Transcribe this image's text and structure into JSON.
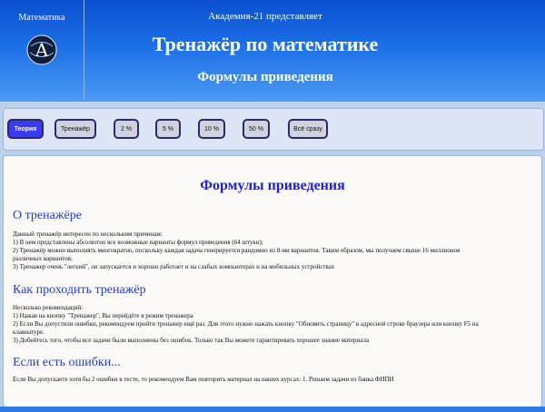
{
  "header": {
    "brand": "Математика",
    "logo_letter": "A",
    "presents": "Академия-21 представляет",
    "title": "Тренажёр по математике",
    "subtitle": "Формулы приведения"
  },
  "nav": {
    "buttons": [
      {
        "label": "Теория"
      },
      {
        "label": "Тренажёр"
      },
      {
        "label": "2 %"
      },
      {
        "label": "5 %"
      },
      {
        "label": "10 %"
      },
      {
        "label": "50 %"
      },
      {
        "label": "Всё сразу"
      }
    ]
  },
  "content": {
    "title": "Формулы приведения",
    "sections": [
      {
        "heading": "О тренажёре",
        "lines": [
          "Данный тренажёр интересен по нескольким причинам:",
          "1) В нем представлены абсолютно все возможные варианты формул приведения (64 штуки);",
          "2) Тренажёр можно выполнять многократно, поскольку каждая задача генерируется рандомно из 8-ми вариантов. Таким образом, мы получаем свыше 16 миллионов",
          "различных вариантов;",
          "3) Тренажер очень \"легкий\", он запускается и хорошо работает и на слабых компьютерах и на мобильных устройствах"
        ]
      },
      {
        "heading": "Как проходить тренажёр",
        "lines": [
          "Несколько рекомендаций:",
          "1) Нажав на кнопку \"Тренажер\", Вы перейдёте в режим тренажера",
          "2) Если Вы допустили ошибки, рекомендуем пройти тренажер ещё раз. Для этого нужно нажать кнопку \"Обновить страницу\" в адресной строке браузера или кнопку F5 на",
          "клавиатуре.",
          "3) Добейтесь того, чтобы все задачи были выполнены без ошибок. Только так Вы можете гарантировать хорошее знание материала"
        ]
      },
      {
        "heading": "Если есть ошибки...",
        "lines": [
          "Если Вы допускаете хотя бы 2 ошибки в тесте, то рекомендуем Вам повторить материал на наших курсах: 1. Решаем задачи из банка ФИПИ"
        ]
      }
    ]
  },
  "colors": {
    "header_top": "#0a4fd0",
    "header_bottom": "#4b9af5",
    "accent_heading": "#1f3fd0",
    "active_button": "#3a3af0"
  }
}
